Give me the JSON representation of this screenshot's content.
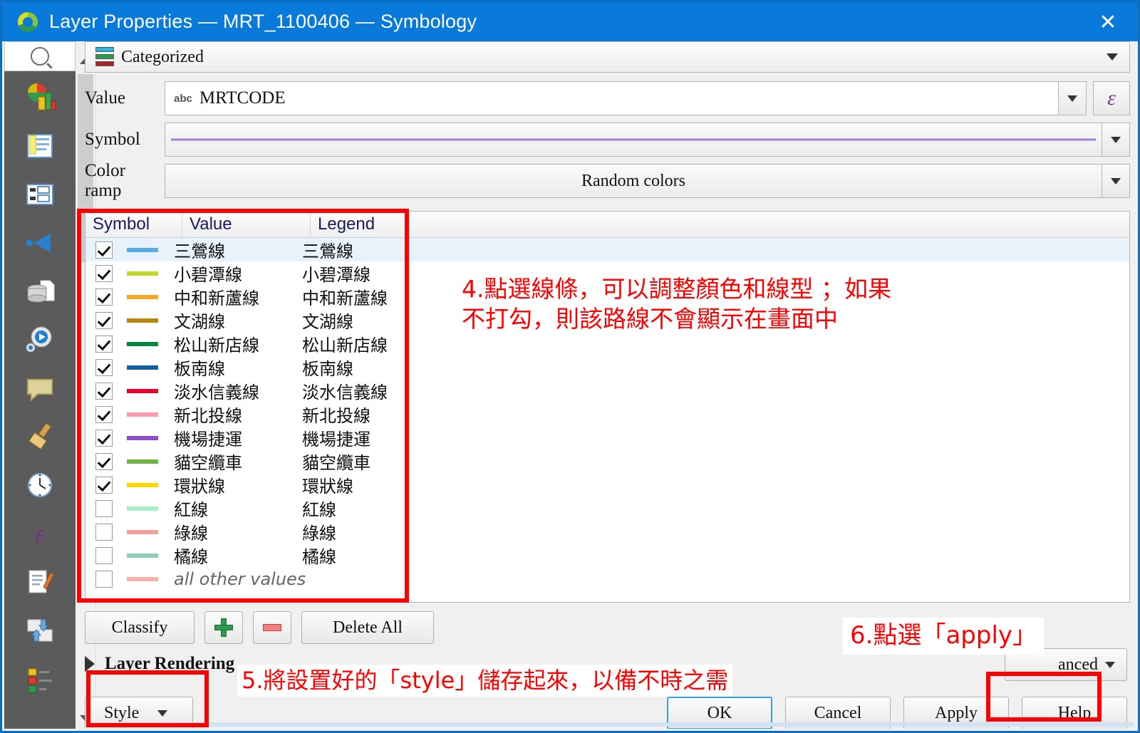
{
  "window": {
    "title": "Layer Properties — MRT_1100406 — Symbology",
    "close_label": "✕",
    "titlebar_color": "#0a7ada"
  },
  "sidebar": {
    "search_placeholder": "",
    "items": [
      {
        "name": "symbology",
        "icon": "symbology-icon"
      },
      {
        "name": "labels",
        "icon": "labels-icon"
      },
      {
        "name": "masks",
        "icon": "masks-icon"
      },
      {
        "name": "3d-view",
        "icon": "three-d-view-icon"
      },
      {
        "name": "source",
        "icon": "database-source-icon"
      },
      {
        "name": "rendering",
        "icon": "gear-play-icon"
      },
      {
        "name": "display",
        "icon": "speech-bubble-icon"
      },
      {
        "name": "actions",
        "icon": "brush-icon"
      },
      {
        "name": "temporal",
        "icon": "clock-icon"
      },
      {
        "name": "variables",
        "icon": "epsilon-icon"
      },
      {
        "name": "metadata",
        "icon": "document-pencil-icon"
      },
      {
        "name": "dependencies",
        "icon": "swap-arrows-icon"
      },
      {
        "name": "legend",
        "icon": "legend-swatches-icon"
      }
    ]
  },
  "renderer": {
    "label": "Categorized",
    "icon": "categorized-icon",
    "bar_colors": [
      "#29b6d8",
      "#2e9b4e",
      "#b22222"
    ]
  },
  "form": {
    "value": {
      "label": "Value",
      "type_tag": "abc",
      "field_name": "MRTCODE",
      "expression_button": "ε"
    },
    "symbol": {
      "label": "Symbol",
      "preview_color": "#9b7fd4"
    },
    "color_ramp": {
      "label": "Color ramp",
      "value": "Random colors"
    }
  },
  "table": {
    "headers": [
      "Symbol",
      "Value",
      "Legend"
    ],
    "rows": [
      {
        "checked": true,
        "color": "#5aaae0",
        "value": "三鶯線",
        "legend": "三鶯線",
        "selected": true
      },
      {
        "checked": true,
        "color": "#c2d92c",
        "value": "小碧潭線",
        "legend": "小碧潭線",
        "selected": false
      },
      {
        "checked": true,
        "color": "#f5a623",
        "value": "中和新蘆線",
        "legend": "中和新蘆線",
        "selected": false
      },
      {
        "checked": true,
        "color": "#b8860b",
        "value": "文湖線",
        "legend": "文湖線",
        "selected": false
      },
      {
        "checked": true,
        "color": "#00843d",
        "value": "松山新店線",
        "legend": "松山新店線",
        "selected": false
      },
      {
        "checked": true,
        "color": "#0f5fa8",
        "value": "板南線",
        "legend": "板南線",
        "selected": false
      },
      {
        "checked": true,
        "color": "#e4002b",
        "value": "淡水信義線",
        "legend": "淡水信義線",
        "selected": false
      },
      {
        "checked": true,
        "color": "#ff9aab",
        "value": "新北投線",
        "legend": "新北投線",
        "selected": false
      },
      {
        "checked": true,
        "color": "#8c4bc7",
        "value": "機場捷運",
        "legend": "機場捷運",
        "selected": false
      },
      {
        "checked": true,
        "color": "#6eb43f",
        "value": "貓空纜車",
        "legend": "貓空纜車",
        "selected": false
      },
      {
        "checked": true,
        "color": "#ffd900",
        "value": "環狀線",
        "legend": "環狀線",
        "selected": false
      },
      {
        "checked": false,
        "color": "#a8f0c8",
        "value": "紅線",
        "legend": "紅線",
        "selected": false
      },
      {
        "checked": false,
        "color": "#f5a09a",
        "value": "綠線",
        "legend": "綠線",
        "selected": false
      },
      {
        "checked": false,
        "color": "#8ecfb4",
        "value": "橘線",
        "legend": "橘線",
        "selected": false
      },
      {
        "checked": false,
        "color": "#f7b3ad",
        "value": "all other values",
        "legend": "",
        "selected": false,
        "italic": true
      }
    ]
  },
  "actions": {
    "classify": "Classify",
    "add": "+",
    "remove": "−",
    "delete_all": "Delete All",
    "advanced": "anced",
    "layer_rendering": "Layer Rendering",
    "style": "Style"
  },
  "dialog_buttons": {
    "ok": "OK",
    "cancel": "Cancel",
    "apply": "Apply",
    "help": "Help"
  },
  "annotations": {
    "color": "#ff0000",
    "note4": "4.點選線條，可以調整顏色和線型 ；如果\n不打勾，則該路線不會顯示在畫面中",
    "note5": "5.將設置好的「style」儲存起來，以備不時之需",
    "note6": "6.點選「apply」"
  }
}
